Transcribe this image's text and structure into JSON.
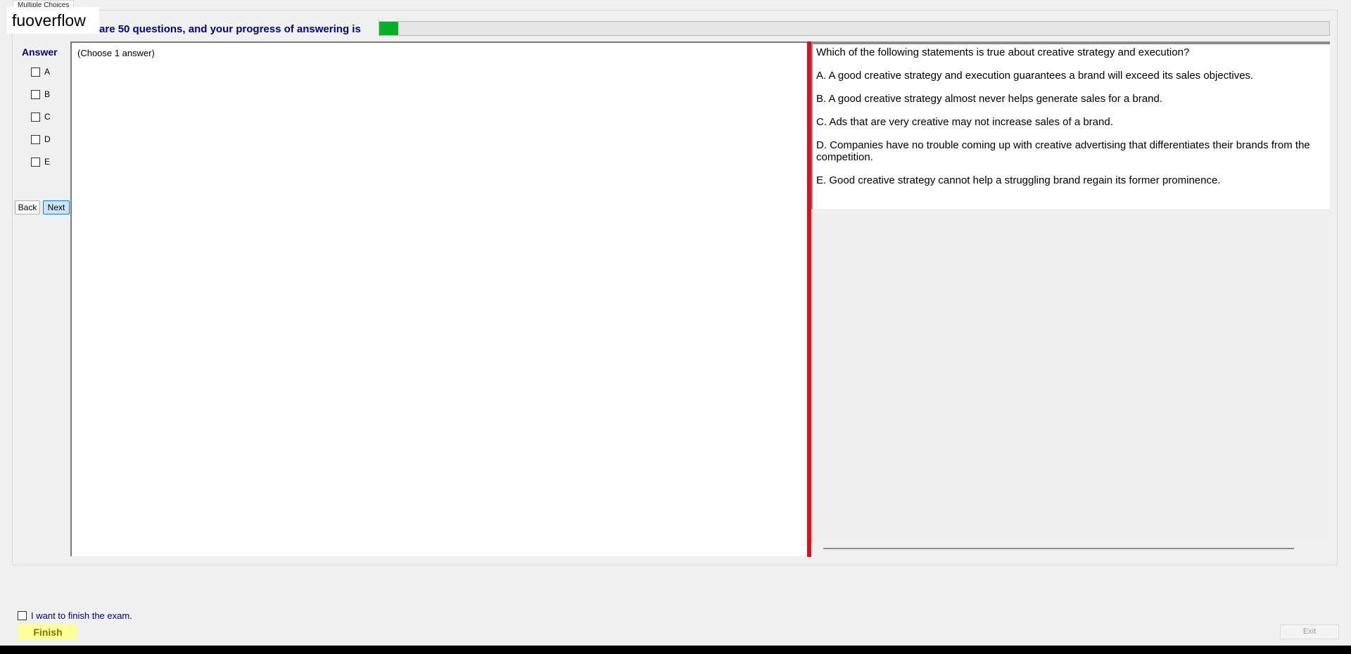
{
  "tab": {
    "label": "Multiple Choices"
  },
  "watermark": {
    "text": "fuoverflow"
  },
  "progress": {
    "label": "There are 50 questions, and your progress of answering is",
    "fraction": 0.02,
    "color": "#06b025"
  },
  "answer": {
    "title": "Answer",
    "options": [
      "A",
      "B",
      "C",
      "D",
      "E"
    ]
  },
  "nav": {
    "back_label": "Back",
    "next_label": "Next"
  },
  "answer_panel": {
    "hint": "(Choose 1 answer)"
  },
  "question": {
    "stem": "Which of the following statements is true about creative strategy and execution?",
    "options": [
      "A.  A good creative strategy and execution guarantees a brand will exceed its sales objectives.",
      "B.  A good creative strategy almost never helps generate sales for a brand.",
      "C.  Ads that are very creative may not increase sales of a brand.",
      "D.  Companies have no trouble coming up with creative advertising that differentiates their brands from the competition.",
      "E.  Good creative strategy cannot help a struggling brand regain its former prominence."
    ]
  },
  "finish": {
    "confirm_label": "I want to finish the exam.",
    "finish_label": "Finish",
    "exit_label": "Exit"
  },
  "colors": {
    "splitter": "#e0101a",
    "accent": "#000080"
  }
}
